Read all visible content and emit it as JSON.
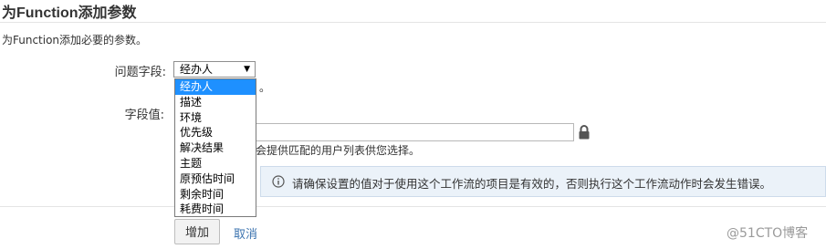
{
  "header": {
    "title": "为Function添加参数"
  },
  "description": "为Function添加必要的参数。",
  "form": {
    "question_field_label": "问题字段:",
    "select_value": "经办人",
    "options": [
      "经办人",
      "描述",
      "环境",
      "优先级",
      "解决结果",
      "主题",
      "原预估时间",
      "剩余时间",
      "耗费时间"
    ],
    "partial_hint_1": "。",
    "field_value_label": "字段值:",
    "field_value": "",
    "partial_hint_2": "会提供匹配的用户列表供您选择。"
  },
  "info": {
    "message": "请确保设置的值对于使用这个工作流的项目是有效的，否则执行这个工作流动作时会发生错误。"
  },
  "actions": {
    "add_label": "增加",
    "cancel_label": "取消"
  },
  "watermark": "@51CTO博客",
  "colors": {
    "accent": "#3b73af",
    "selected": "#1e90ff",
    "info_bg": "#ebf2f9"
  },
  "icons": {
    "lock": "lock-icon",
    "info": "info-icon",
    "dropdown": "chevron-down-icon"
  }
}
